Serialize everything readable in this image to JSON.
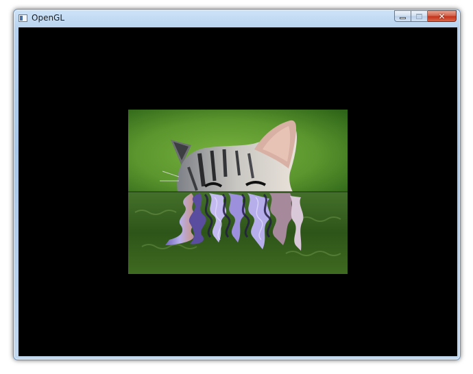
{
  "window": {
    "title": "OpenGL",
    "icon": "opengl-app-icon",
    "controls": {
      "minimize_icon": "minimize-icon",
      "maximize_icon": "maximize-icon",
      "close_icon": "close-icon",
      "close_glyph": "✕"
    }
  },
  "viewport": {
    "background": "#000000",
    "scene": "kitten-water-reflection"
  },
  "colors": {
    "grass_light": "#6ea93a",
    "grass_dark": "#2f6a18",
    "water": "#2c4a18",
    "reflection": "#9f93d6",
    "close_button": "#c7402a"
  }
}
